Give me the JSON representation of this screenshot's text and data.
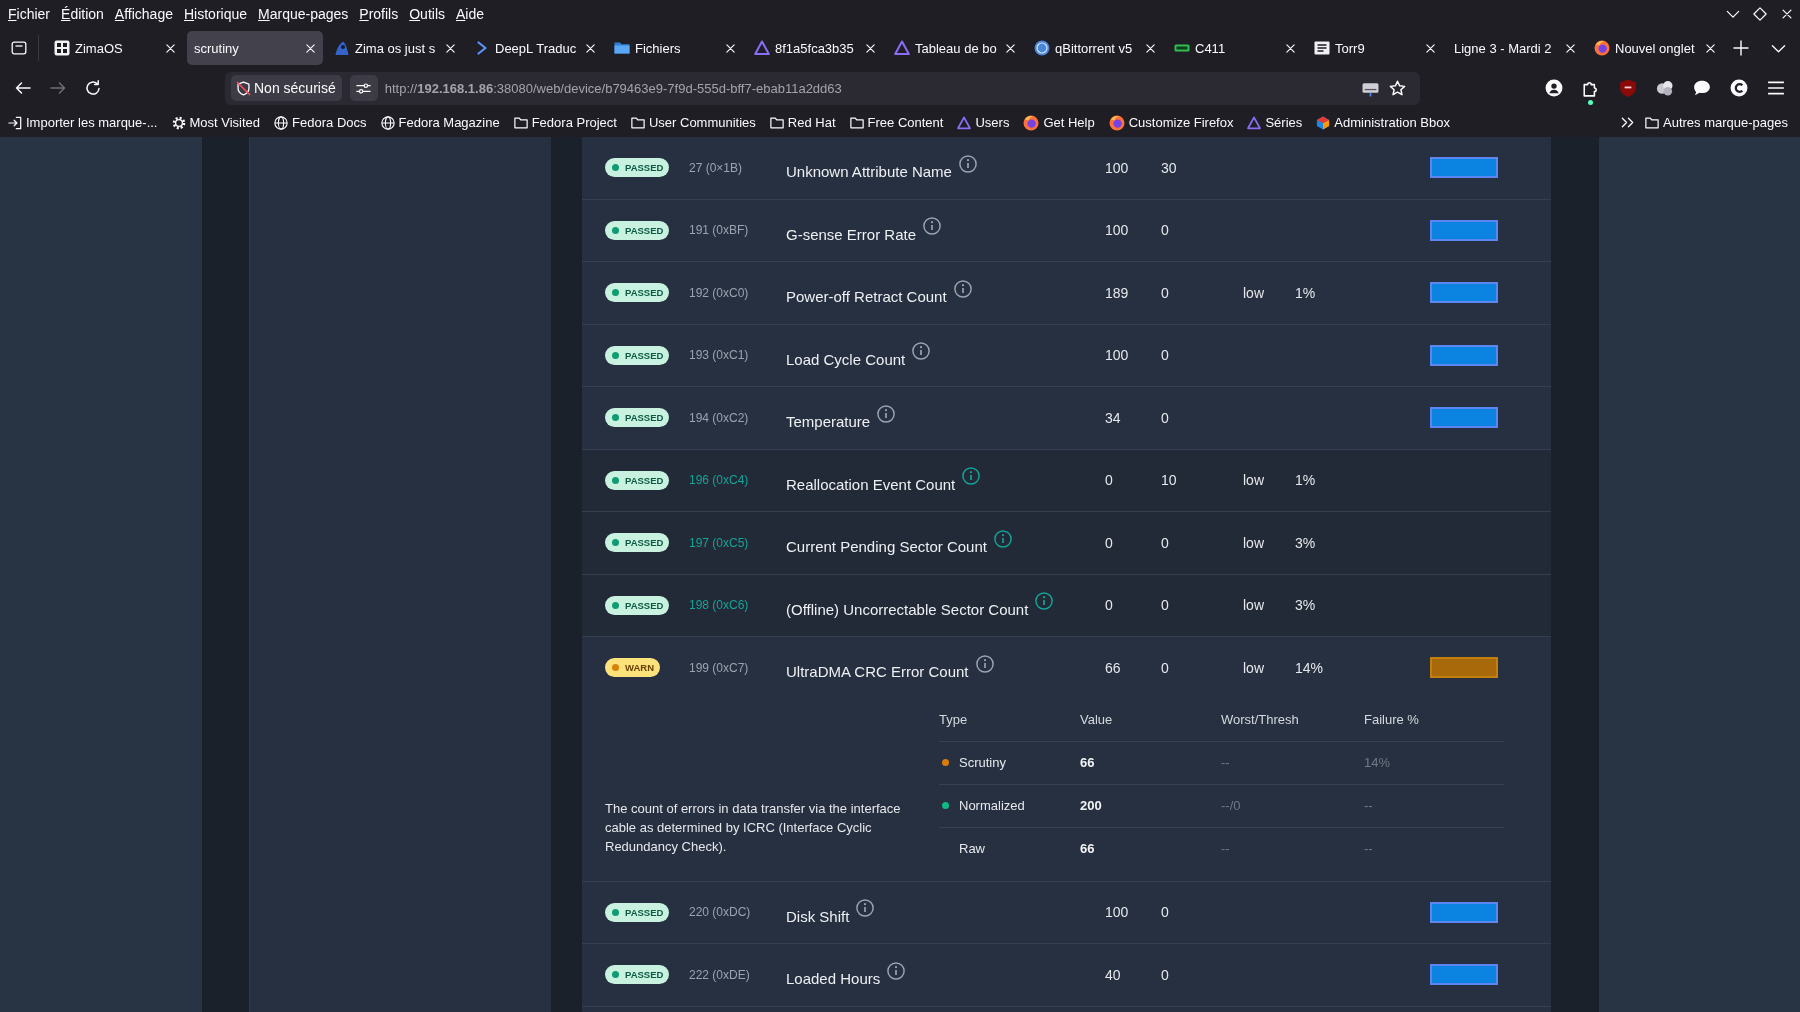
{
  "menu_bar": {
    "items": [
      "Fichier",
      "Édition",
      "Affichage",
      "Historique",
      "Marque-pages",
      "Profils",
      "Outils",
      "Aide"
    ]
  },
  "tabs": [
    {
      "kind": "grid",
      "title": "ZimaOS",
      "selected": false
    },
    {
      "title": "scrutiny",
      "selected": true
    },
    {
      "kind": "figure",
      "title": "Zima os just s",
      "selected": false
    },
    {
      "kind": "chevron",
      "title": "DeepL Traduc",
      "selected": false
    },
    {
      "kind": "folder",
      "title": "Fichiers",
      "selected": false
    },
    {
      "kind": "triangle",
      "title": "8f1a5fca3b35",
      "selected": false
    },
    {
      "kind": "triangle",
      "title": "Tableau de bo",
      "selected": false
    },
    {
      "kind": "circle",
      "title": "qBittorrent v5",
      "selected": false
    },
    {
      "kind": "label",
      "title": "C411",
      "selected": false
    },
    {
      "kind": "box",
      "title": "Torr9",
      "selected": false
    },
    {
      "title": "Ligne 3 - Mardi 2",
      "selected": false
    },
    {
      "kind": "browser",
      "title": "Nouvel onglet",
      "selected": false
    }
  ],
  "nav_buttons": [
    {
      "kind": "back",
      "disabled": false
    },
    {
      "kind": "forward",
      "disabled": true
    },
    {
      "kind": "reload",
      "disabled": false
    }
  ],
  "address_bar": {
    "security_label": "Non sécurisé",
    "url": "http://**192.168.1.86**:38080/web/device/b79463e9-7f9d-555d-bff7-ebab11a2dd63"
  },
  "bookmarks_bar": {
    "items": [
      {
        "kind": "import",
        "label": "Importer les marque-..."
      },
      {
        "kind": "gear",
        "label": "Most Visited"
      },
      {
        "kind": "globe",
        "label": "Fedora Docs"
      },
      {
        "kind": "globe",
        "label": "Fedora Magazine"
      },
      {
        "kind": "folder",
        "label": "Fedora Project"
      },
      {
        "kind": "folder",
        "label": "User Communities"
      },
      {
        "kind": "folder",
        "label": "Red Hat"
      },
      {
        "kind": "folder",
        "label": "Free Content"
      },
      {
        "kind": "triangle",
        "label": "Users"
      },
      {
        "kind": "browser",
        "label": "Get Help"
      },
      {
        "kind": "browser",
        "label": "Customize Firefox"
      },
      {
        "kind": "triangle",
        "label": "Séries"
      },
      {
        "kind": "cube",
        "label": "Administration Bbox"
      }
    ],
    "other": {
      "kind": "folder",
      "label": "Autres marque-pages"
    }
  },
  "attributes": [
    {
      "kind": "passed",
      "status": "PASSED",
      "attribute_id": "27 (0×1B)",
      "name": "Unknown Attribute Name",
      "value": "100",
      "column_5": "30",
      "history_bar": true,
      "highlighted": false,
      "expanded": false
    },
    {
      "kind": "passed",
      "status": "PASSED",
      "attribute_id": "191 (0xBF)",
      "name": "G-sense Error Rate",
      "value": "100",
      "column_5": "0",
      "history_bar": true,
      "highlighted": false,
      "expanded": false
    },
    {
      "kind": "passed",
      "status": "PASSED",
      "attribute_id": "192 (0xC0)",
      "name": "Power-off Retract Count",
      "value": "189",
      "column_5": "0",
      "column_6": "low",
      "failure_rate": "1%",
      "history_bar": true,
      "highlighted": false,
      "expanded": false
    },
    {
      "kind": "passed",
      "status": "PASSED",
      "attribute_id": "193 (0xC1)",
      "name": "Load Cycle Count",
      "value": "100",
      "column_5": "0",
      "history_bar": true,
      "highlighted": false,
      "expanded": false
    },
    {
      "kind": "passed",
      "status": "PASSED",
      "attribute_id": "194 (0xC2)",
      "name": "Temperature",
      "value": "34",
      "column_5": "0",
      "history_bar": true,
      "highlighted": false,
      "expanded": false
    },
    {
      "kind": "passed",
      "status": "PASSED",
      "attribute_id": "196 (0xC4)",
      "name": "Reallocation Event Count",
      "value": "0",
      "column_5": "10",
      "column_6": "low",
      "failure_rate": "1%",
      "history_bar": false,
      "highlighted": true,
      "expanded": false
    },
    {
      "kind": "passed",
      "status": "PASSED",
      "attribute_id": "197 (0xC5)",
      "name": "Current Pending Sector Count",
      "value": "0",
      "column_5": "0",
      "column_6": "low",
      "failure_rate": "3%",
      "history_bar": false,
      "highlighted": true,
      "expanded": false
    },
    {
      "kind": "passed",
      "status": "PASSED",
      "attribute_id": "198 (0xC6)",
      "name": "(Offline) Uncorrectable Sector Count",
      "value": "0",
      "column_5": "0",
      "column_6": "low",
      "failure_rate": "3%",
      "history_bar": false,
      "highlighted": true,
      "expanded": false
    },
    {
      "kind": "warn",
      "status": "WARN",
      "attribute_id": "199 (0xC7)",
      "name": "UltraDMA CRC Error Count",
      "value": "66",
      "column_5": "0",
      "column_6": "low",
      "failure_rate": "14%",
      "history_bar": true,
      "highlighted": false,
      "expanded": true,
      "description": "The count of errors in data transfer via the interface cable as determined by ICRC (Interface Cyclic Redundancy Check).",
      "detail": {
        "columns": [
          "Type",
          "Value",
          "Worst/Thresh",
          "Failure %"
        ],
        "rows": [
          {
            "type": "Scrutiny",
            "color": "#d97c0c",
            "value": "66",
            "worst_thresh": "--",
            "failure": "14%"
          },
          {
            "type": "Normalized",
            "color": "#10b981",
            "value": "200",
            "worst_thresh": "--/0",
            "failure": "--"
          },
          {
            "type": "Raw",
            "value": "66",
            "worst_thresh": "--",
            "failure": "--"
          }
        ]
      }
    },
    {
      "kind": "passed",
      "status": "PASSED",
      "attribute_id": "220 (0xDC)",
      "name": "Disk Shift",
      "value": "100",
      "column_5": "0",
      "history_bar": true,
      "highlighted": false,
      "expanded": false
    },
    {
      "kind": "passed",
      "status": "PASSED",
      "attribute_id": "222 (0xDE)",
      "name": "Loaded Hours",
      "value": "40",
      "column_5": "0",
      "history_bar": true,
      "highlighted": false,
      "expanded": false
    }
  ]
}
